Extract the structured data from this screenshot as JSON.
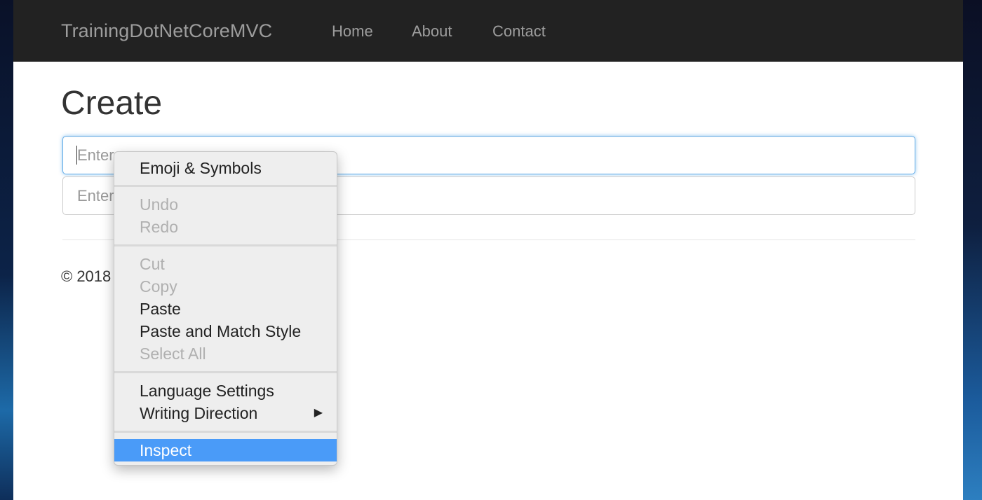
{
  "navbar": {
    "brand": "TrainingDotNetCoreMVC",
    "links": [
      "Home",
      "About",
      "Contact"
    ]
  },
  "main": {
    "title": "Create",
    "inputs": [
      {
        "placeholder": "Enter",
        "value": ""
      },
      {
        "placeholder": "Enter",
        "value": ""
      }
    ],
    "footer": "© 2018"
  },
  "context_menu": {
    "items": [
      {
        "label": "Emoji & Symbols",
        "enabled": true
      },
      {
        "label": "Undo",
        "enabled": false
      },
      {
        "label": "Redo",
        "enabled": false
      },
      {
        "label": "Cut",
        "enabled": false
      },
      {
        "label": "Copy",
        "enabled": false
      },
      {
        "label": "Paste",
        "enabled": true
      },
      {
        "label": "Paste and Match Style",
        "enabled": true
      },
      {
        "label": "Select All",
        "enabled": false
      },
      {
        "label": "Language Settings",
        "enabled": true
      },
      {
        "label": "Writing Direction",
        "enabled": true,
        "submenu": true
      },
      {
        "label": "Inspect",
        "enabled": true,
        "highlighted": true
      }
    ],
    "submenu_icon": "triangle-right-icon"
  },
  "colors": {
    "navbar_bg": "#222222",
    "nav_text": "#9d9d9d",
    "focus_border": "#66afe9",
    "menu_highlight": "#4a9bf8"
  }
}
